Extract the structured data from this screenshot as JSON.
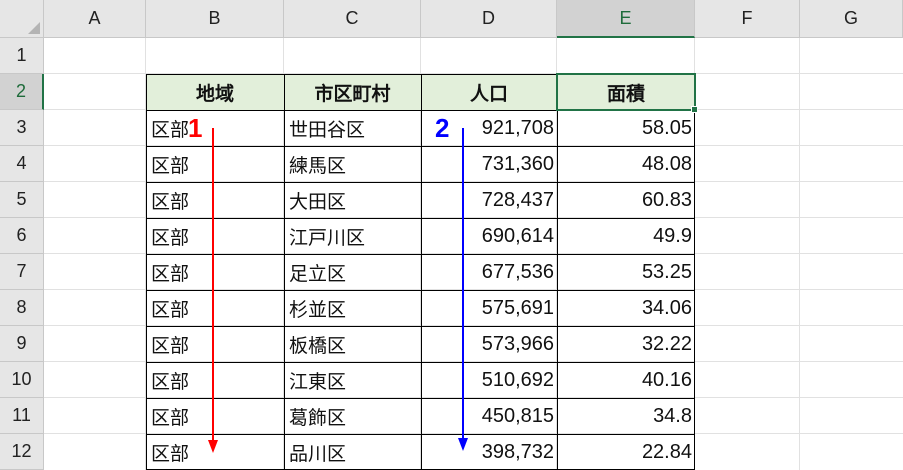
{
  "columns": [
    "A",
    "B",
    "C",
    "D",
    "E",
    "F",
    "G"
  ],
  "rows": [
    "1",
    "2",
    "3",
    "4",
    "5",
    "6",
    "7",
    "8",
    "9",
    "10",
    "11",
    "12"
  ],
  "header": {
    "region": "地域",
    "municipality": "市区町村",
    "population": "人口",
    "area": "面積"
  },
  "table": [
    {
      "region": "区部",
      "municipality": "世田谷区",
      "population": "921,708",
      "area": "58.05"
    },
    {
      "region": "区部",
      "municipality": "練馬区",
      "population": "731,360",
      "area": "48.08"
    },
    {
      "region": "区部",
      "municipality": "大田区",
      "population": "728,437",
      "area": "60.83"
    },
    {
      "region": "区部",
      "municipality": "江戸川区",
      "population": "690,614",
      "area": "49.9"
    },
    {
      "region": "区部",
      "municipality": "足立区",
      "population": "677,536",
      "area": "53.25"
    },
    {
      "region": "区部",
      "municipality": "杉並区",
      "population": "575,691",
      "area": "34.06"
    },
    {
      "region": "区部",
      "municipality": "板橋区",
      "population": "573,966",
      "area": "32.22"
    },
    {
      "region": "区部",
      "municipality": "江東区",
      "population": "510,692",
      "area": "40.16"
    },
    {
      "region": "区部",
      "municipality": "葛飾区",
      "population": "450,815",
      "area": "34.8"
    },
    {
      "region": "区部",
      "municipality": "品川区",
      "population": "398,732",
      "area": "22.84"
    }
  ],
  "annotations": [
    {
      "label": "1",
      "color": "#ff0000"
    },
    {
      "label": "2",
      "color": "#0000ff"
    }
  ],
  "selected_cell": "E2",
  "accent_color": "#217346"
}
